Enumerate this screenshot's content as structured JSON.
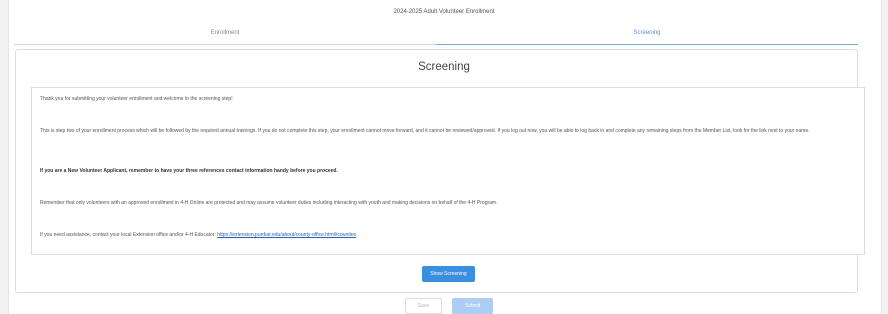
{
  "header": {
    "title": "2024-2025 Adult Volunteer Enrollment"
  },
  "tabs": [
    {
      "label": "Enrollment",
      "active": false
    },
    {
      "label": "Screening",
      "active": true
    }
  ],
  "screening": {
    "heading": "Screening",
    "paragraphs": {
      "p1": "Thank you for submitting your volunteer enrollment and welcome to the screening step!",
      "p2": "This is step two of your enrollment process which will be followed by the required annual trainings. If you do not complete this step, your enrollment cannot move forward, and it cannot be reviewed/approved. If you log out now, you will be able to log back in and complete any remaining steps from the Member List, look for the link next to your name.",
      "p3": "If you are a New Volunteer Applicant, remember to have your three references contact information handy before you proceed.",
      "p4": "Remember that only volunteers with an approved enrollment in 4-H Online are protected and may assume volunteer duties including interacting with youth and making decisions on behalf of the 4-H Program.",
      "p5_prefix": "If you need assistance, contact your local Extension office and/or 4-H Educator:",
      "p5_link": "https://extension.purdue.edu/about/county-office.html#counties"
    },
    "show_button": "Show Screening"
  },
  "footer": {
    "save_label": "Save",
    "submit_label": "Submit"
  },
  "colors": {
    "primary": "#3b8fe0",
    "primary_disabled": "#aecdf2",
    "link": "#2a5fb0",
    "tab_active": "#5b8fd0"
  }
}
